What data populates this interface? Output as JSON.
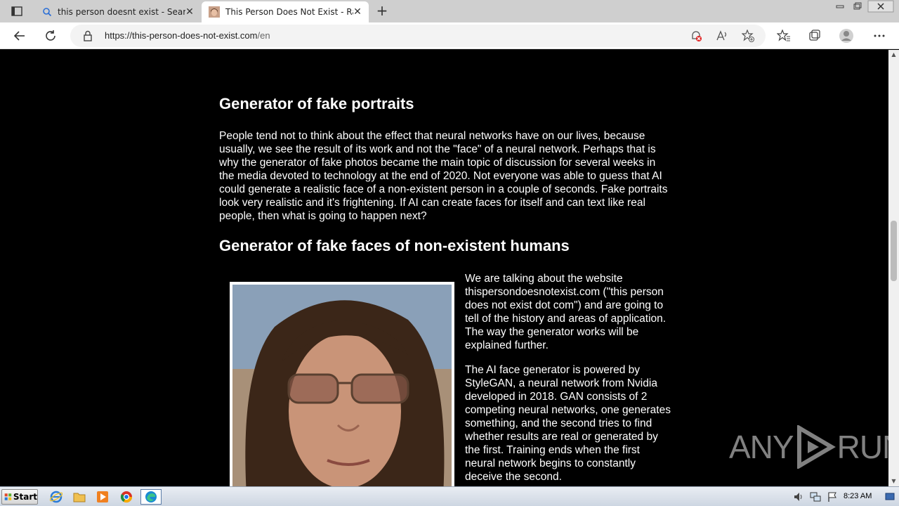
{
  "browser": {
    "tabs": [
      {
        "title": "this person doesnt exist - Search",
        "active": false
      },
      {
        "title": "This Person Does Not Exist - Rand",
        "active": true
      }
    ],
    "url_host": "https://this-person-does-not-exist.com",
    "url_path": "/en"
  },
  "article": {
    "heading1": "Generator of fake portraits",
    "para1": "People tend not to think about the effect that neural networks have on our lives, because usually, we see the result of its work and not the \"face\" of a neural network. Perhaps that is why the generator of fake photos became the main topic of discussion for several weeks in the media devoted to technology at the end of 2020. Not everyone was able to guess that AI could generate a realistic face of a non-existent person in a couple of seconds. Fake portraits look very realistic and it's frightening. If AI can create faces for itself and can text like real people, then what is going to happen next?",
    "heading2": "Generator of fake faces of non-existent humans",
    "side1": "We are talking about the website thispersondoesnotexist.com (\"this person does not exist dot com\") and are going to tell of the history and areas of application. The way the generator works will be explained further.",
    "side2": "The AI face generator is powered by StyleGAN, a neural network from Nvidia developed in 2018. GAN consists of 2 competing neural networks, one generates something, and the second tries to find whether results are real or generated by the first. Training ends when the first neural network begins to constantly deceive the second."
  },
  "watermark": {
    "left": "ANY",
    "right": "RUN"
  },
  "taskbar": {
    "start_label": "Start",
    "clock": "8:23 AM"
  }
}
